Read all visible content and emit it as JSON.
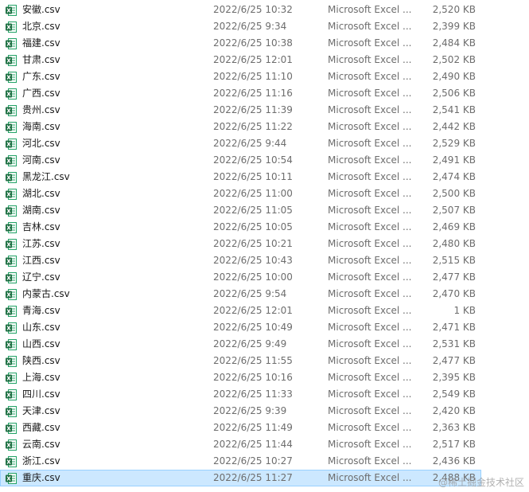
{
  "colors": {
    "selection_bg": "#cce8ff",
    "selection_border": "#99d1ff",
    "excel_green": "#1d6f42",
    "secondary_text": "#6d6d6d"
  },
  "file_icon": "excel-csv-file-icon",
  "files": [
    {
      "name": "安徽.csv",
      "modified": "2022/6/25 10:32",
      "type": "Microsoft Excel ...",
      "size": "2,520 KB"
    },
    {
      "name": "北京.csv",
      "modified": "2022/6/25 9:34",
      "type": "Microsoft Excel ...",
      "size": "2,399 KB"
    },
    {
      "name": "福建.csv",
      "modified": "2022/6/25 10:38",
      "type": "Microsoft Excel ...",
      "size": "2,484 KB"
    },
    {
      "name": "甘肃.csv",
      "modified": "2022/6/25 12:01",
      "type": "Microsoft Excel ...",
      "size": "2,502 KB"
    },
    {
      "name": "广东.csv",
      "modified": "2022/6/25 11:10",
      "type": "Microsoft Excel ...",
      "size": "2,490 KB"
    },
    {
      "name": "广西.csv",
      "modified": "2022/6/25 11:16",
      "type": "Microsoft Excel ...",
      "size": "2,506 KB"
    },
    {
      "name": "贵州.csv",
      "modified": "2022/6/25 11:39",
      "type": "Microsoft Excel ...",
      "size": "2,541 KB"
    },
    {
      "name": "海南.csv",
      "modified": "2022/6/25 11:22",
      "type": "Microsoft Excel ...",
      "size": "2,442 KB"
    },
    {
      "name": "河北.csv",
      "modified": "2022/6/25 9:44",
      "type": "Microsoft Excel ...",
      "size": "2,529 KB"
    },
    {
      "name": "河南.csv",
      "modified": "2022/6/25 10:54",
      "type": "Microsoft Excel ...",
      "size": "2,491 KB"
    },
    {
      "name": "黑龙江.csv",
      "modified": "2022/6/25 10:11",
      "type": "Microsoft Excel ...",
      "size": "2,474 KB"
    },
    {
      "name": "湖北.csv",
      "modified": "2022/6/25 11:00",
      "type": "Microsoft Excel ...",
      "size": "2,500 KB"
    },
    {
      "name": "湖南.csv",
      "modified": "2022/6/25 11:05",
      "type": "Microsoft Excel ...",
      "size": "2,507 KB"
    },
    {
      "name": "吉林.csv",
      "modified": "2022/6/25 10:05",
      "type": "Microsoft Excel ...",
      "size": "2,469 KB"
    },
    {
      "name": "江苏.csv",
      "modified": "2022/6/25 10:21",
      "type": "Microsoft Excel ...",
      "size": "2,480 KB"
    },
    {
      "name": "江西.csv",
      "modified": "2022/6/25 10:43",
      "type": "Microsoft Excel ...",
      "size": "2,515 KB"
    },
    {
      "name": "辽宁.csv",
      "modified": "2022/6/25 10:00",
      "type": "Microsoft Excel ...",
      "size": "2,477 KB"
    },
    {
      "name": "内蒙古.csv",
      "modified": "2022/6/25 9:54",
      "type": "Microsoft Excel ...",
      "size": "2,470 KB"
    },
    {
      "name": "青海.csv",
      "modified": "2022/6/25 12:01",
      "type": "Microsoft Excel ...",
      "size": "1 KB"
    },
    {
      "name": "山东.csv",
      "modified": "2022/6/25 10:49",
      "type": "Microsoft Excel ...",
      "size": "2,471 KB"
    },
    {
      "name": "山西.csv",
      "modified": "2022/6/25 9:49",
      "type": "Microsoft Excel ...",
      "size": "2,531 KB"
    },
    {
      "name": "陕西.csv",
      "modified": "2022/6/25 11:55",
      "type": "Microsoft Excel ...",
      "size": "2,477 KB"
    },
    {
      "name": "上海.csv",
      "modified": "2022/6/25 10:16",
      "type": "Microsoft Excel ...",
      "size": "2,395 KB"
    },
    {
      "name": "四川.csv",
      "modified": "2022/6/25 11:33",
      "type": "Microsoft Excel ...",
      "size": "2,549 KB"
    },
    {
      "name": "天津.csv",
      "modified": "2022/6/25 9:39",
      "type": "Microsoft Excel ...",
      "size": "2,420 KB"
    },
    {
      "name": "西藏.csv",
      "modified": "2022/6/25 11:49",
      "type": "Microsoft Excel ...",
      "size": "2,363 KB"
    },
    {
      "name": "云南.csv",
      "modified": "2022/6/25 11:44",
      "type": "Microsoft Excel ...",
      "size": "2,517 KB"
    },
    {
      "name": "浙江.csv",
      "modified": "2022/6/25 10:27",
      "type": "Microsoft Excel ...",
      "size": "2,436 KB"
    },
    {
      "name": "重庆.csv",
      "modified": "2022/6/25 11:27",
      "type": "Microsoft Excel ...",
      "size": "2,488 KB",
      "selected": true
    }
  ],
  "watermark": "@稀土掘金技术社区"
}
